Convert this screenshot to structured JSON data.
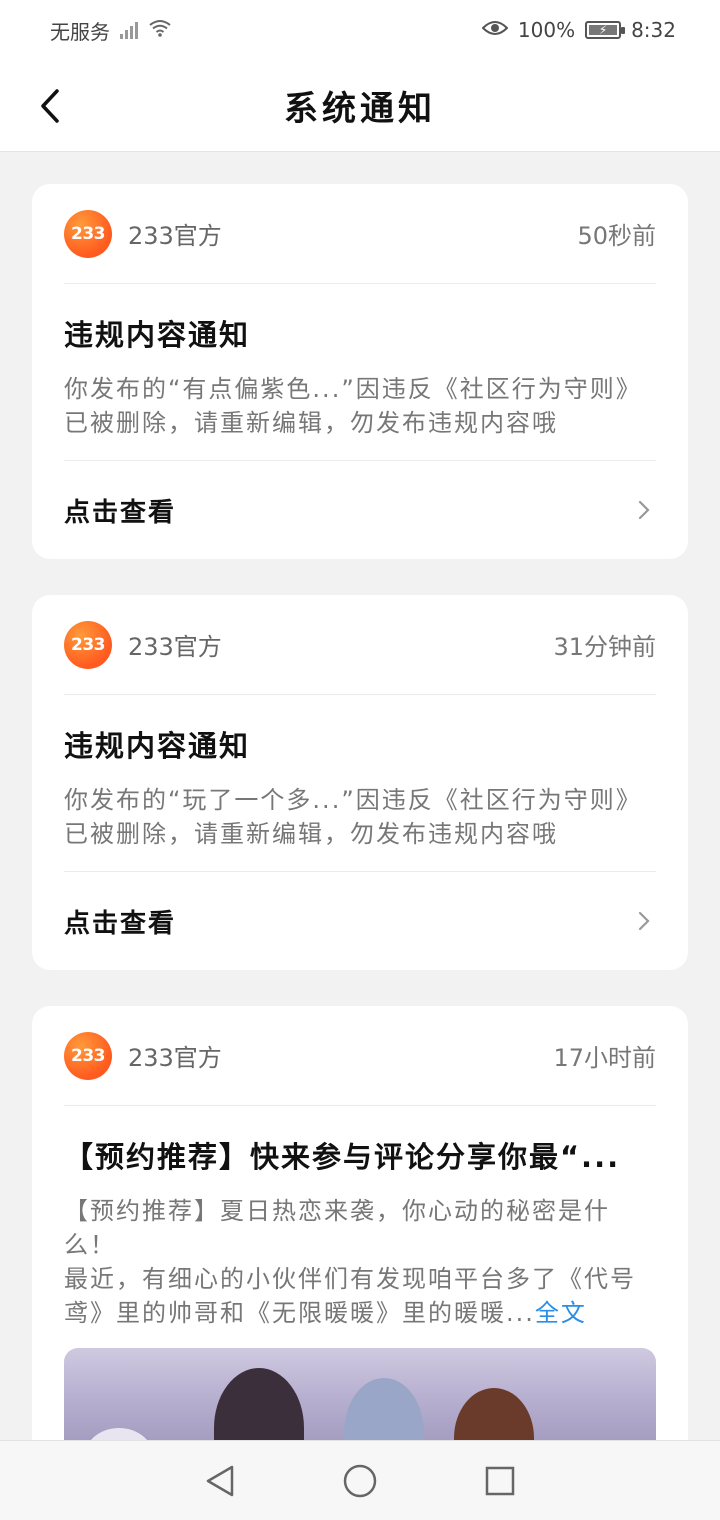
{
  "status_bar": {
    "carrier": "无服务",
    "battery_pct": "100%",
    "time": "8:32"
  },
  "header": {
    "title": "系统通知"
  },
  "notifications": [
    {
      "sender": "233官方",
      "logo_text": "233",
      "time": "50秒前",
      "title": "违规内容通知",
      "body": "你发布的“有点偏紫色...”因违反《社区行为守则》已被删除，请重新编辑，勿发布违规内容哦",
      "footer": "点击查看"
    },
    {
      "sender": "233官方",
      "logo_text": "233",
      "time": "31分钟前",
      "title": "违规内容通知",
      "body": "你发布的“玩了一个多...”因违反《社区行为守则》已被删除，请重新编辑，勿发布违规内容哦",
      "footer": "点击查看"
    },
    {
      "sender": "233官方",
      "logo_text": "233",
      "time": "17小时前",
      "title": "【预约推荐】快来参与评论分享你最“...",
      "body_line1": "【预约推荐】夏日热恋来袭，你心动的秘密是什么！",
      "body_line2": "最近，有细心的小伙伴们有发现咱平台多了《代号鸢》里的帅哥和《无限暖暖》里的暖暖...",
      "more": "全文"
    }
  ],
  "colors": {
    "accent_link": "#2a8ee8",
    "logo_orange": "#ff5a1f",
    "background": "#f2f2f2"
  }
}
